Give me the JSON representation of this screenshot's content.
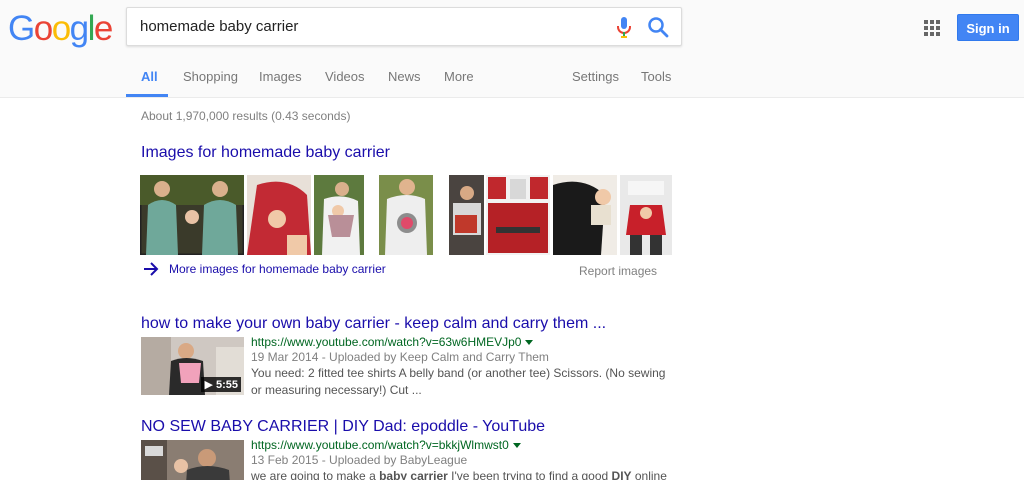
{
  "header": {
    "logo_letters": [
      "G",
      "o",
      "o",
      "g",
      "l",
      "e"
    ],
    "logo_colors": [
      "#4285f4",
      "#ea4335",
      "#fbbc05",
      "#4285f4",
      "#34a853",
      "#ea4335"
    ],
    "search_value": "homemade baby carrier",
    "sign_in_label": "Sign in"
  },
  "tabs": {
    "all": "All",
    "shopping": "Shopping",
    "images": "Images",
    "videos": "Videos",
    "news": "News",
    "more": "More",
    "settings": "Settings",
    "tools": "Tools"
  },
  "results_stats": "About 1,970,000 results (0.43 seconds)",
  "images_block": {
    "title": "Images for homemade baby carrier",
    "more_link": "More images for homemade baby carrier",
    "report": "Report images"
  },
  "results": [
    {
      "title": "how to make your own baby carrier - keep calm and carry them ...",
      "url": "https://www.youtube.com/watch?v=63w6HMEVJp0",
      "date": "19 Mar 2014 - Uploaded by Keep Calm and Carry Them",
      "snippet": "You need: 2 fitted tee shirts A belly band (or another tee) Scissors. (No sewing or measuring necessary!) Cut ...",
      "duration": "▶ 5:55"
    },
    {
      "title": "NO SEW BABY CARRIER | DIY Dad: epoddle - YouTube",
      "url": "https://www.youtube.com/watch?v=bkkjWlmwst0",
      "date": "13 Feb 2015 - Uploaded by BabyLeague",
      "snippet_parts": [
        "we are going to make a ",
        "baby carrier",
        " I've been trying to find a good ",
        "DIY",
        " online"
      ]
    }
  ],
  "colors": {
    "link": "#1a0dab",
    "url": "#006621",
    "accent": "#4285f4"
  }
}
